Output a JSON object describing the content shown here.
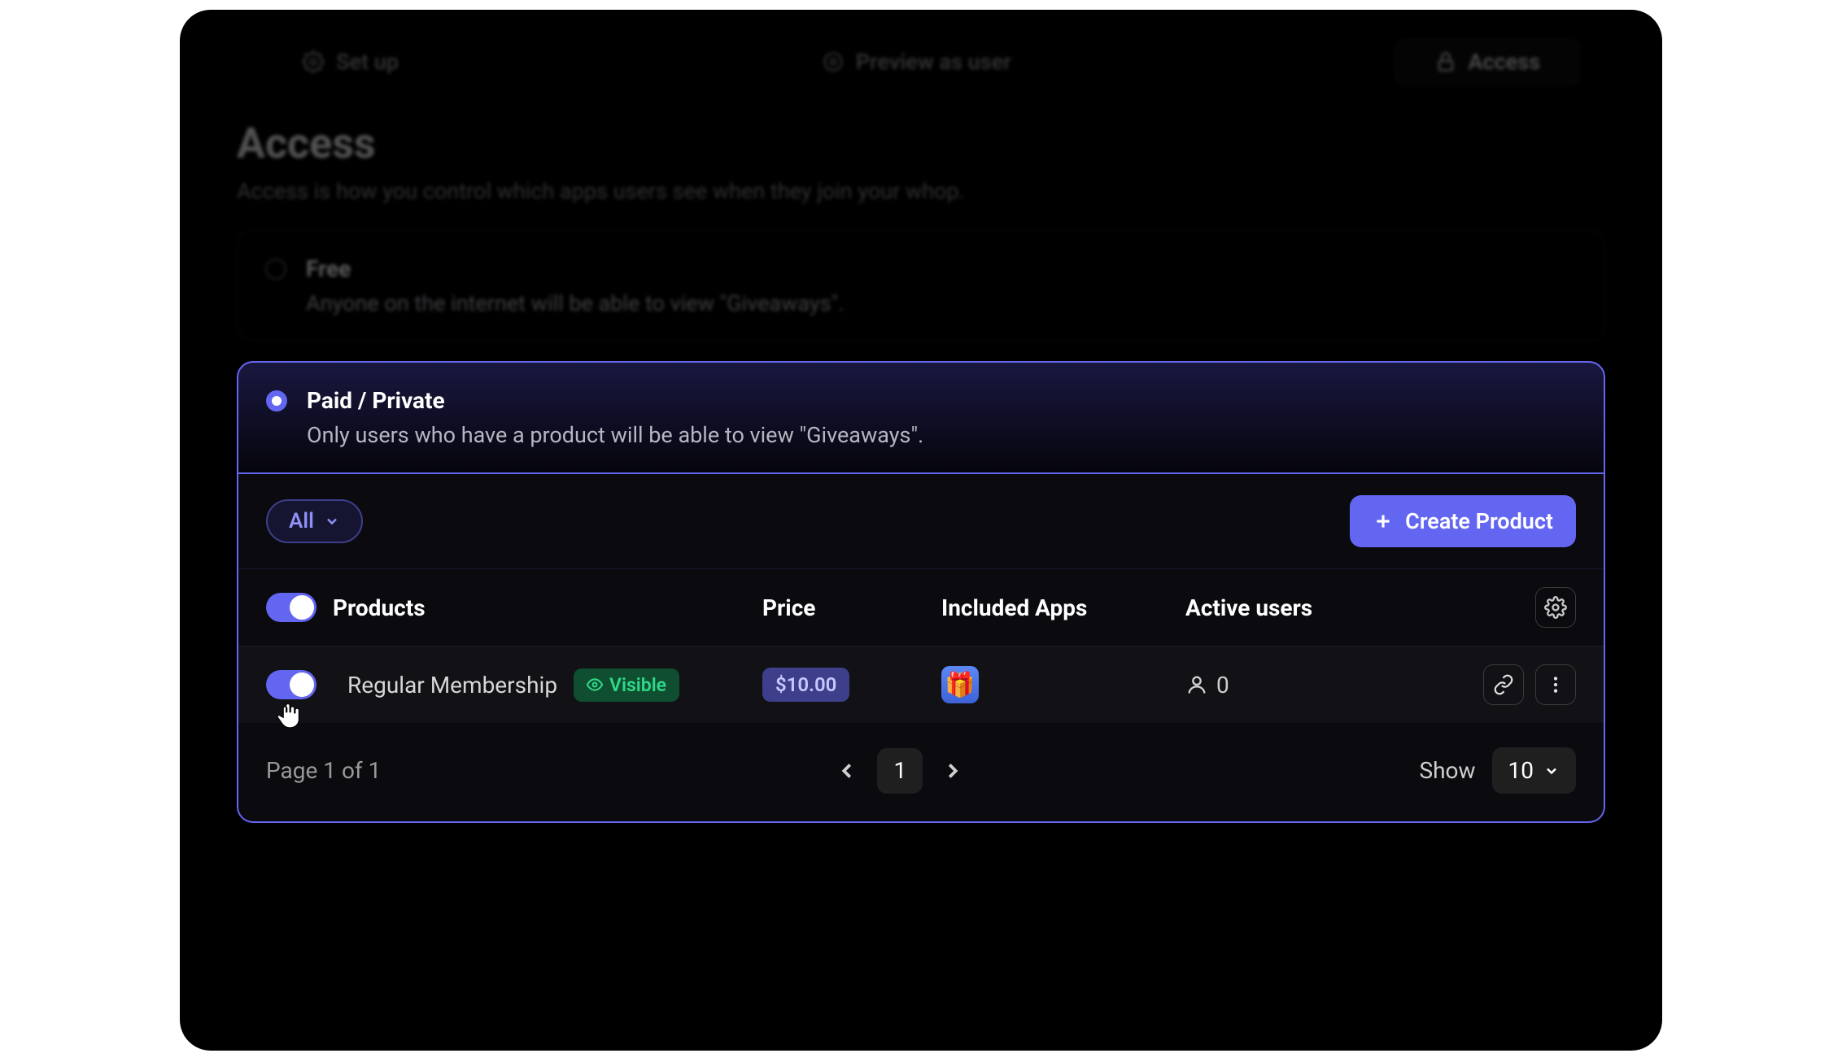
{
  "tabs": {
    "setup": "Set up",
    "preview": "Preview as user",
    "access": "Access"
  },
  "header": {
    "title": "Access",
    "description": "Access is how you control which apps users see when they join your whop."
  },
  "options": {
    "free": {
      "title": "Free",
      "description": "Anyone on the internet will be able to view \"Giveaways\"."
    },
    "paid": {
      "title": "Paid / Private",
      "description": "Only users who have a product will be able to view \"Giveaways\"."
    }
  },
  "toolbar": {
    "filter_label": "All",
    "create_label": "Create Product"
  },
  "table": {
    "headers": {
      "products": "Products",
      "price": "Price",
      "included_apps": "Included Apps",
      "active_users": "Active users"
    },
    "rows": [
      {
        "name": "Regular Membership",
        "visibility": "Visible",
        "price": "$10.00",
        "app_icon": "🎁",
        "active_users": "0"
      }
    ]
  },
  "pagination": {
    "status": "Page 1 of 1",
    "current_page": "1",
    "show_label": "Show",
    "per_page": "10"
  }
}
